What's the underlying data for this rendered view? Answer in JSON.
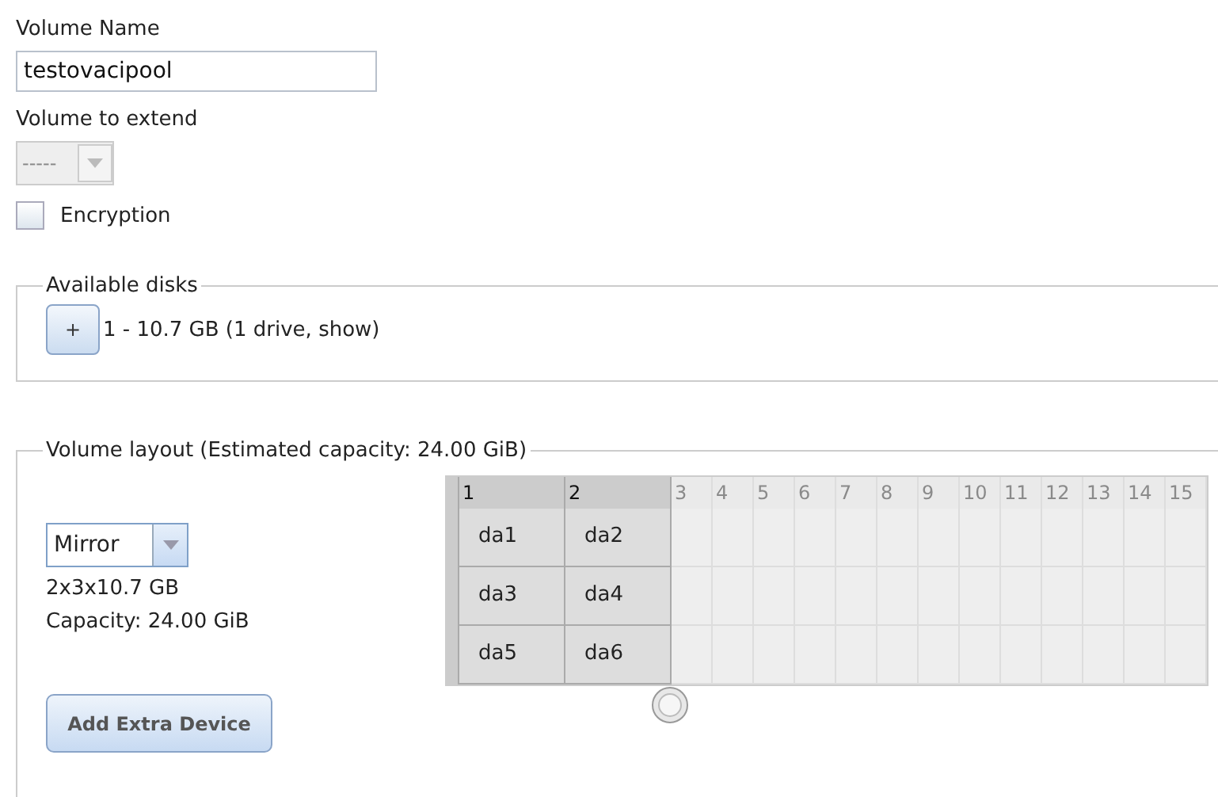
{
  "volume_name": {
    "label": "Volume Name",
    "value": "testovacipool"
  },
  "volume_to_extend": {
    "label": "Volume to extend",
    "value": "-----",
    "disabled": true
  },
  "encryption": {
    "label": "Encryption",
    "checked": false
  },
  "available_disks": {
    "legend": "Available disks",
    "groups": [
      {
        "button": "+",
        "text": "1 - 10.7 GB (1 drive, show)"
      }
    ]
  },
  "volume_layout": {
    "legend": "Volume layout (Estimated capacity: 24.00 GiB)",
    "layout": "Mirror",
    "geometry": "2x3x10.7 GB",
    "capacity": "Capacity: 24.00 GiB",
    "add_button": "Add Extra Device",
    "grid": {
      "columns": [
        {
          "label": "1",
          "active": true
        },
        {
          "label": "2",
          "active": true
        },
        {
          "label": "3",
          "active": false
        },
        {
          "label": "4",
          "active": false
        },
        {
          "label": "5",
          "active": false
        },
        {
          "label": "6",
          "active": false
        },
        {
          "label": "7",
          "active": false
        },
        {
          "label": "8",
          "active": false
        },
        {
          "label": "9",
          "active": false
        },
        {
          "label": "10",
          "active": false
        },
        {
          "label": "11",
          "active": false
        },
        {
          "label": "12",
          "active": false
        },
        {
          "label": "13",
          "active": false
        },
        {
          "label": "14",
          "active": false
        },
        {
          "label": "15",
          "active": false
        }
      ],
      "rows": [
        [
          "da1",
          "da2"
        ],
        [
          "da3",
          "da4"
        ],
        [
          "da5",
          "da6"
        ]
      ]
    }
  }
}
